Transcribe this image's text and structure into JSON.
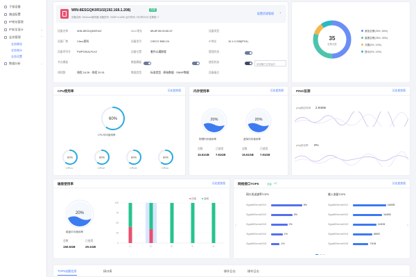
{
  "sidebar": {
    "items": [
      {
        "label": "于链设备",
        "icon": "device-icon"
      },
      {
        "label": "路由配置",
        "icon": "route-icon"
      },
      {
        "label": "IP地址管理",
        "icon": "ip-icon"
      },
      {
        "label": "IP安全设计",
        "icon": "shield-icon"
      },
      {
        "label": "业务管理",
        "icon": "business-icon"
      }
    ],
    "subitems": [
      "业务概览",
      "业务统计",
      "业务设置"
    ],
    "last_item": "数据分析"
  },
  "header": {
    "title": "WIN-8ESGQK0R102(192.168.1.208)",
    "badge": "在线",
    "subline": "设备名称: Windows服务器  设备型号: 2008Pro 64Bit  运行时间: 9天3时40分  告警数: 2",
    "config_link": "配置资源管理"
  },
  "info": {
    "rows": [
      [
        [
          "设备名称",
          "WIN-8ESGQK0R102"
        ],
        [
          "MAC地址",
          "6B:8F:55:00:5D:47"
        ],
        [
          "设备类型",
          ""
        ]
      ],
      [
        [
          "设备厂商",
          "Cisco思科"
        ],
        [
          "设备型号",
          "CISCO 3560-24"
        ],
        [
          "IP地址",
          "10.1.0.228(IPV4)"
        ]
      ],
      [
        [
          "设备序列号",
          "FWP23KALFLK2"
        ],
        [
          "设备位置",
          "着作以通联楼"
        ],
        [
          "管理状态",
          ""
        ]
      ],
      [
        [
          "节点模板",
          ""
        ],
        [
          "数据模板",
          ""
        ],
        [
          "使用状态",
          ""
        ]
      ],
      [
        [
          "线程数",
          "线程 16.28 · 线程 20.51"
        ],
        [
          "数据类型",
          "标准类型 · 原始数据 · SNMP数据"
        ],
        [
          "设备备注",
          ""
        ]
      ]
    ],
    "state_placeholder": "该设备已正常运行"
  },
  "status_donut": {
    "total": "35",
    "total_label": "告警总数",
    "legend": [
      {
        "label": "紧急告警(25%, 50%)",
        "color": "#6a8ef5",
        "value": 50
      },
      {
        "label": "重要告警(25%, 30%)",
        "color": "#4cc4ad",
        "value": 30
      },
      {
        "label": "次要(5%, 10%)",
        "color": "#f2b84b",
        "value": 10
      },
      {
        "label": "提示(5%, 10%)",
        "color": "#2ab7c9",
        "value": 10
      }
    ]
  },
  "cpu": {
    "title": "CPU使用率",
    "link": "历史趋势图",
    "main_value": "60%",
    "main_label": "CPU平均使用率",
    "main_fraction": 0.6,
    "cores": [
      {
        "label": "CPU1",
        "value": "60%",
        "fraction": 0.6
      },
      {
        "label": "CPU2",
        "value": "60%",
        "fraction": 0.6
      },
      {
        "label": "CPU3",
        "value": "60%",
        "fraction": 0.6
      },
      {
        "label": "CPUx",
        "value": "60%",
        "fraction": 0.6
      }
    ]
  },
  "memory": {
    "title": "内存使用率",
    "link": "历史趋势图",
    "gauges": [
      {
        "value": "20%",
        "label": "物理内存使用率",
        "total_label": "总数",
        "total": "15.51GB",
        "used_label": "已使用",
        "used": "7.91GB"
      },
      {
        "value": "20%",
        "label": "虚拟内存使用率",
        "total_label": "总数",
        "total": "15.51GB",
        "used_label": "已使用",
        "used": "7.91GB"
      }
    ]
  },
  "ping": {
    "title": "PING监测",
    "link": "历史趋势图",
    "rows": [
      {
        "label": "ping响应时间",
        "value": "2.94Ms"
      },
      {
        "label": "ping丢包率",
        "value": "0%"
      }
    ]
  },
  "disk": {
    "title": "磁盘使用率",
    "link": "历史趋势图",
    "value": "20%",
    "value_label": "磁盘平均使用率",
    "total_label": "总数",
    "total": "150.5GB",
    "used_label": "已使用",
    "used": "29.1GB",
    "legend_used": "已用",
    "legend_free": "空闲"
  },
  "chart_data": {
    "type": "bar",
    "categories": [
      "C:",
      "D:",
      "E:",
      "F:",
      "G:"
    ],
    "series": [
      {
        "name": "已用",
        "values": [
          40,
          35,
          0,
          0,
          0
        ]
      },
      {
        "name": "空闲",
        "values": [
          60,
          65,
          100,
          100,
          100
        ]
      }
    ],
    "ylim": [
      0,
      100
    ],
    "colors": {
      "used": "#e8506e",
      "free": "#27c38f",
      "highlight": "#d9e6ff"
    }
  },
  "network": {
    "title": "网络接口TOP5",
    "badges": [
      "流量",
      "4/7"
    ],
    "link": "历史趋势图",
    "out_title": "网口发送速率TOP5",
    "in_title": "输入流量TOP5",
    "out_rows": [
      {
        "label": "GigabitEthernet0/0/1",
        "value": "8%",
        "fraction": 0.8
      },
      {
        "label": "GigabitEthernet0/0/2",
        "value": "5%",
        "fraction": 0.55
      },
      {
        "label": "GigabitEthernet0/0/3",
        "value": "2%",
        "fraction": 0.42
      },
      {
        "label": "GigabitEthernet0/0/4",
        "value": "1%",
        "fraction": 0.3
      },
      {
        "label": "GigabitEthernet0/0/5",
        "value": "1%",
        "fraction": 0.22
      }
    ],
    "in_rows": [
      {
        "label": "GigabitEthernet0/0/1",
        "value": "184KB",
        "fraction": 0.85
      },
      {
        "label": "GigabitEthernet0/0/2",
        "value": "164KB",
        "fraction": 0.75
      },
      {
        "label": "GigabitEthernet0/0/3",
        "value": "110KB",
        "fraction": 0.6
      },
      {
        "label": "GigabitEthernet0/0/4",
        "value": "86KB",
        "fraction": 0.5
      },
      {
        "label": "GigabitEthernet0/0/5",
        "value": "71KB",
        "fraction": 0.4
      }
    ]
  },
  "bottom_tabs": [
    "TOP5流量信息",
    "接口表",
    "操作日志",
    "操作日志"
  ]
}
